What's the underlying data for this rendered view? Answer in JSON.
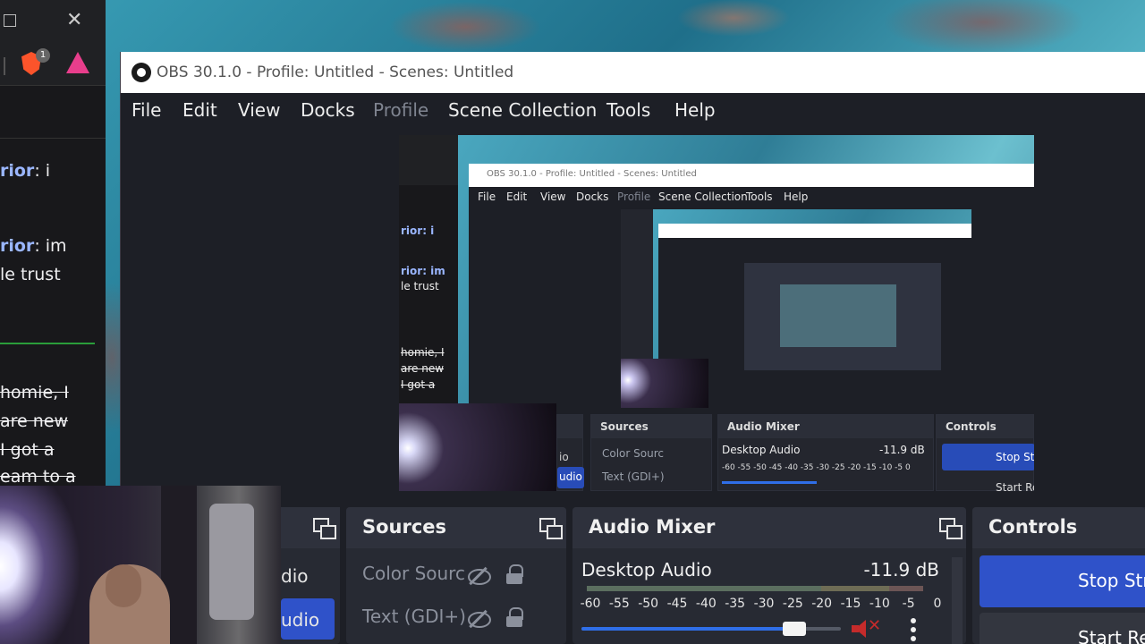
{
  "background_app": {
    "badge_count": "1",
    "chat": [
      {
        "name": "rior",
        "text": ": i"
      },
      {
        "name": "rior",
        "text": ": im"
      },
      {
        "name": "",
        "text": "le trust"
      },
      {
        "name": "",
        "text": "homie, I"
      },
      {
        "name": "",
        "text": "are new"
      },
      {
        "name": "",
        "text": "I got a"
      },
      {
        "name": "",
        "text": "eam to a"
      }
    ]
  },
  "obs": {
    "title": "OBS 30.1.0 - Profile: Untitled - Scenes: Untitled",
    "menu": {
      "file": "File",
      "edit": "Edit",
      "view": "View",
      "docks": "Docks",
      "profile": "Profile",
      "scene_collection": "Scene Collection",
      "tools": "Tools",
      "help": "Help"
    },
    "preview": {
      "title": "OBS 30.1.0 - Profile: Untitled - Scenes: Untitled",
      "menu": [
        "File",
        "Edit",
        "View",
        "Docks",
        "Profile",
        "Scene Collection",
        "Tools",
        "Help"
      ],
      "chat": [
        "rior: i",
        "rior: im",
        "le trust",
        "homie, I",
        "are new",
        "I got a",
        "eam to a"
      ],
      "docks": {
        "sources": "Sources",
        "mixer": "Audio Mixer",
        "controls": "Controls",
        "scene_items": [
          "io",
          "udio"
        ],
        "source_items": [
          "Color Sourc",
          "Text (GDI+)"
        ],
        "mixer_name": "Desktop Audio",
        "mixer_db": "-11.9 dB",
        "mixer_ticks": "-60 -55 -50 -45 -40 -35 -30 -25 -20 -15 -10 -5 0",
        "stop_btn": "Stop Str",
        "start_btn": "Start Re"
      },
      "inner_docks": {
        "sources": "Sources",
        "mixer": "Audio Mixer",
        "controls": "Controls",
        "source_items": [
          "Color Sour",
          "Text (GDI+)"
        ],
        "mixer_name": "Desktop Audio",
        "mixer_db": "-11.9 dB",
        "stop_btn": "Stop St",
        "start_btn": "Start Re"
      }
    },
    "scenes": {
      "items": [
        "dio",
        "udio"
      ]
    },
    "sources": {
      "title": "Sources",
      "items": [
        "Color Sourc",
        "Text (GDI+)"
      ]
    },
    "audio_mixer": {
      "title": "Audio Mixer",
      "channel": "Desktop Audio",
      "level": "-11.9 dB",
      "volume": 0.82,
      "ticks": [
        "-60",
        "-55",
        "-50",
        "-45",
        "-40",
        "-35",
        "-30",
        "-25",
        "-20",
        "-15",
        "-10",
        "-5",
        "0"
      ]
    },
    "controls": {
      "title": "Controls",
      "stop_stream": "Stop Str",
      "start_record": "Start Re"
    }
  },
  "colors": {
    "obs_bg": "#1d1f26",
    "dock_bg": "#272a33",
    "accent_blue": "#2f52c9",
    "mute_red": "#c52b2b",
    "chat_name": "#9ab6ff"
  }
}
